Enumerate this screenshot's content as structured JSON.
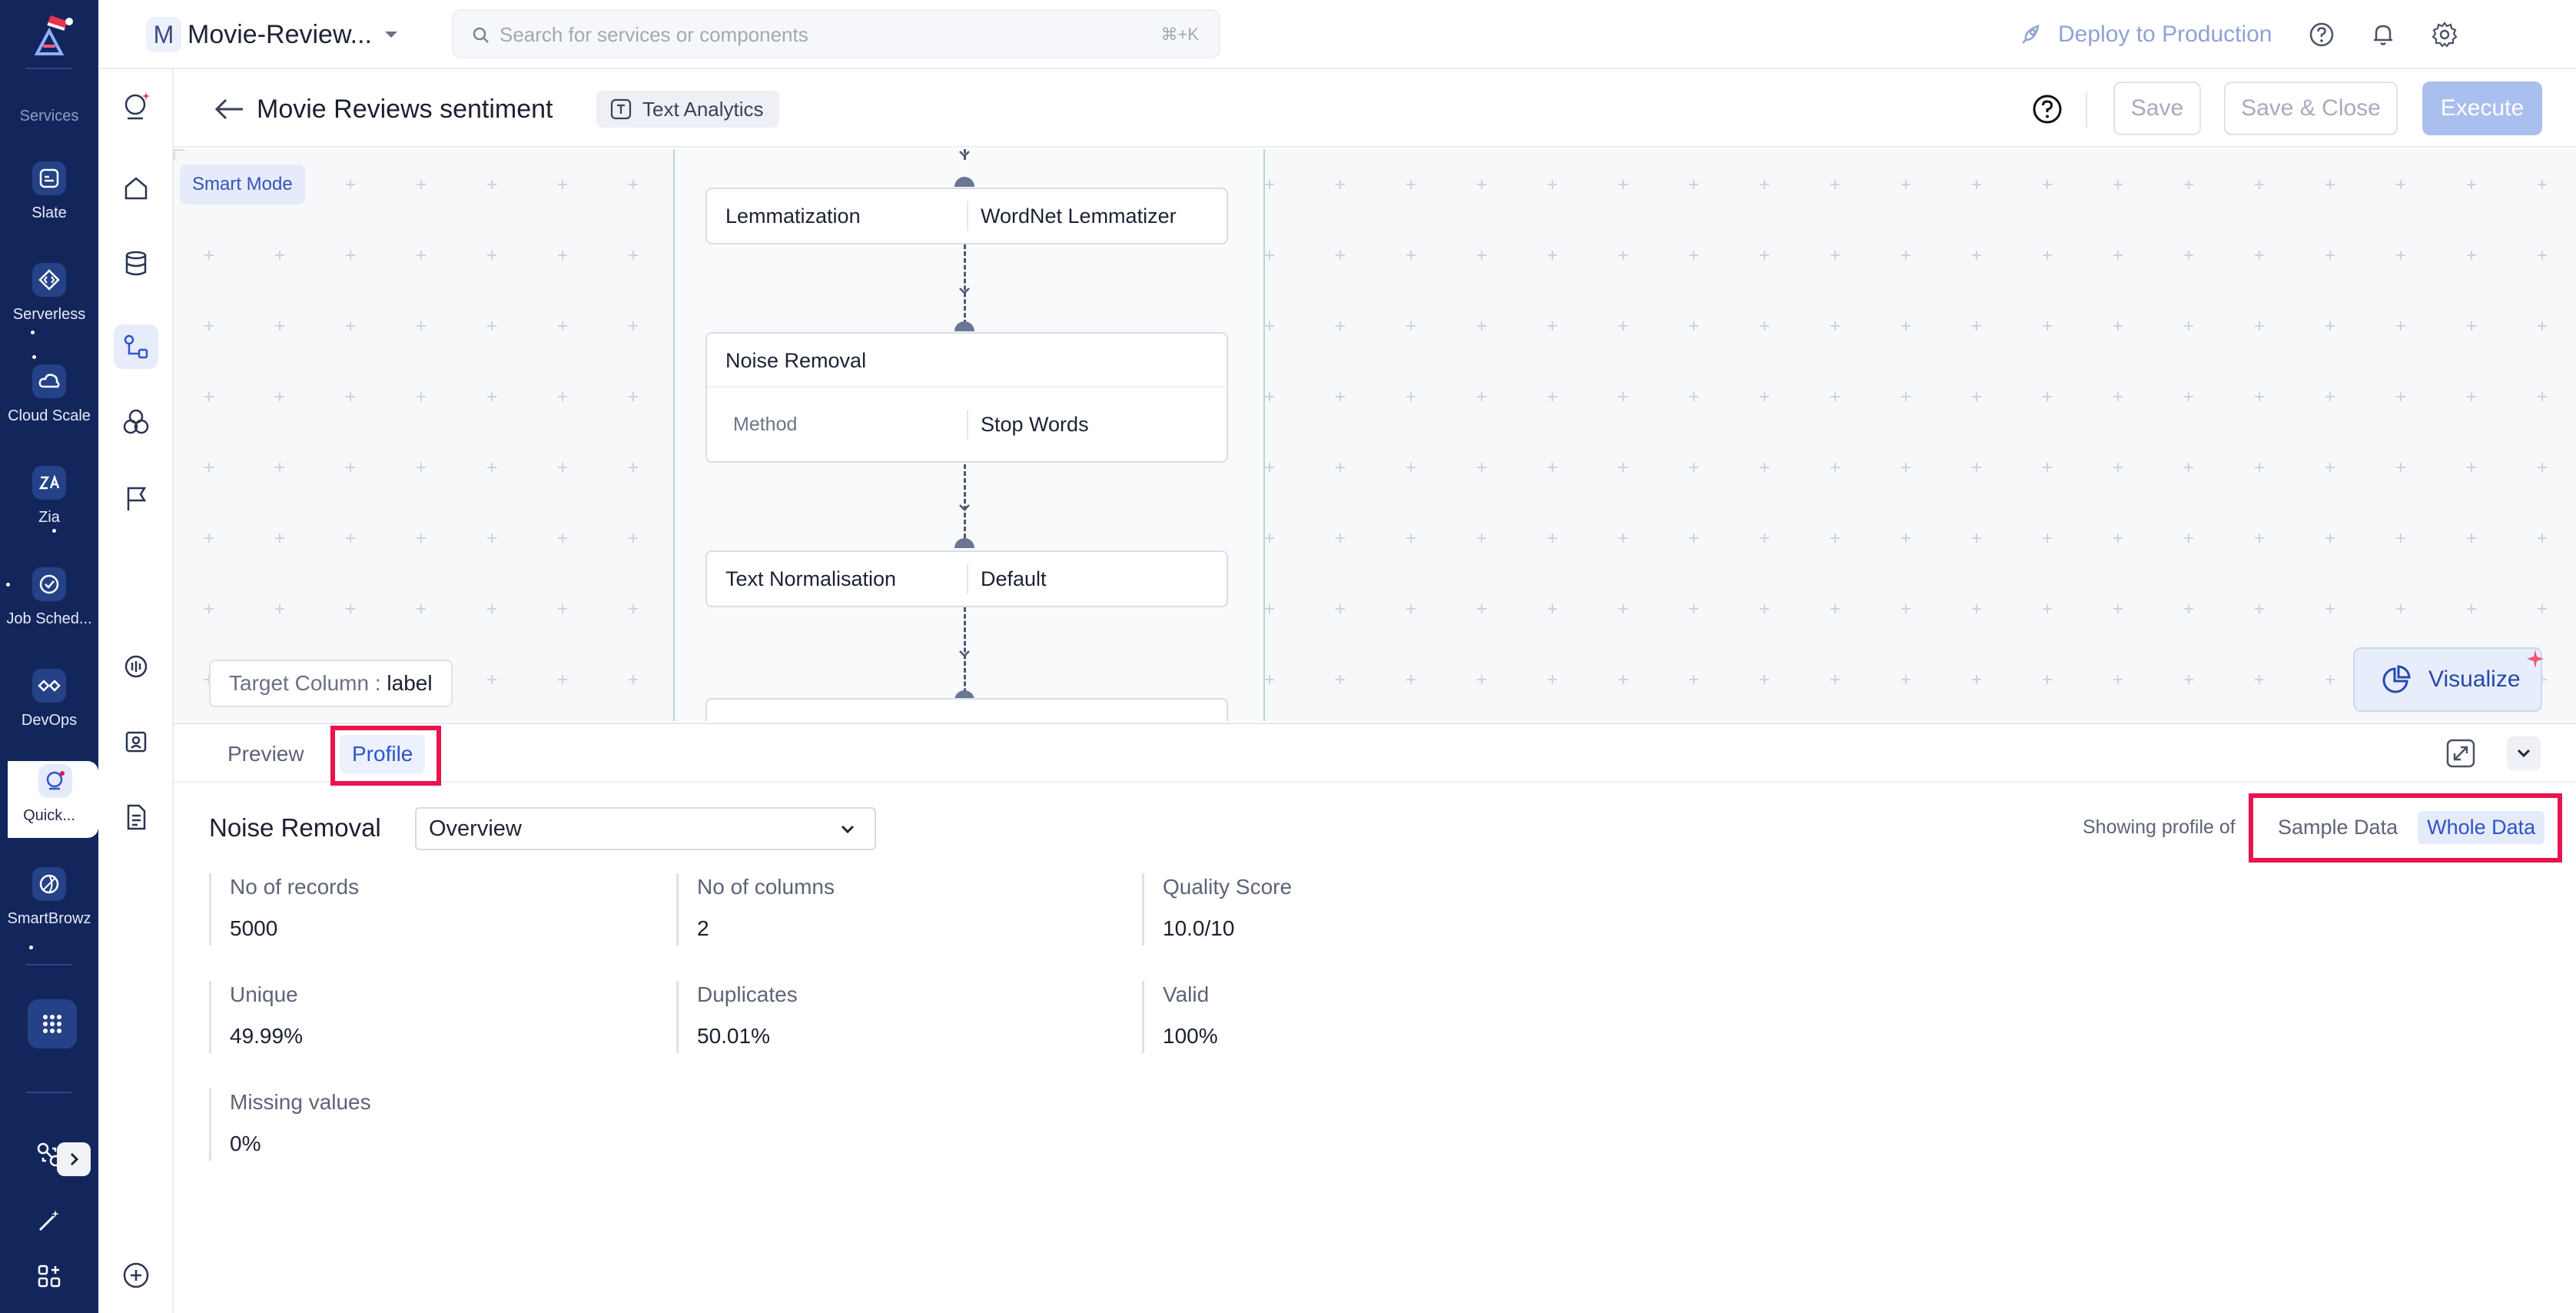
{
  "rail": {
    "section_label": "Services",
    "items": [
      {
        "label": "Slate",
        "icon": "slate-icon"
      },
      {
        "label": "Serverless",
        "icon": "serverless-icon"
      },
      {
        "label": "Cloud Scale",
        "icon": "cloud-scale-icon"
      },
      {
        "label": "Zia",
        "icon": "zia-icon"
      },
      {
        "label": "Job Sched...",
        "icon": "job-scheduler-icon"
      },
      {
        "label": "DevOps",
        "icon": "devops-icon"
      },
      {
        "label": "Quick...",
        "icon": "quickml-icon"
      },
      {
        "label": "SmartBrowz",
        "icon": "smartbrowz-icon"
      }
    ],
    "active_item": "Quick..."
  },
  "topbar": {
    "project_initial": "M",
    "project_name": "Movie-Review...",
    "search_placeholder": "Search for services or components",
    "search_shortcut": "⌘+K",
    "deploy_label": "Deploy to Production"
  },
  "page": {
    "title": "Movie Reviews sentiment",
    "tag": "Text Analytics",
    "save_label": "Save",
    "save_close_label": "Save & Close",
    "execute_label": "Execute"
  },
  "canvas": {
    "smart_mode_label": "Smart Mode",
    "nodes": [
      {
        "label": "Lemmatization",
        "value": "WordNet Lemmatizer"
      },
      {
        "title": "Noise Removal",
        "sub_label": "Method",
        "sub_value": "Stop Words"
      },
      {
        "label": "Text Normalisation",
        "value": "Default"
      }
    ],
    "target_column_label": "Target Column :",
    "target_column_value": "label",
    "visualize_label": "Visualize"
  },
  "panel": {
    "tabs": [
      "Preview",
      "Profile"
    ],
    "active_tab": "Profile",
    "step_title": "Noise Removal",
    "view_select": "Overview",
    "showing_label": "Showing profile of",
    "data_options": [
      "Sample Data",
      "Whole Data"
    ],
    "active_data_option": "Whole Data",
    "stats": [
      {
        "label": "No of records",
        "value": "5000"
      },
      {
        "label": "No of columns",
        "value": "2"
      },
      {
        "label": "Quality Score",
        "value": "10.0/10"
      },
      {
        "label": "Unique",
        "value": "49.99%"
      },
      {
        "label": "Duplicates",
        "value": "50.01%"
      },
      {
        "label": "Valid",
        "value": "100%"
      },
      {
        "label": "Missing values",
        "value": "0%"
      }
    ]
  },
  "colors": {
    "rail_bg": "#13265c",
    "accent": "#2e55c6",
    "highlight_box": "#e8144f",
    "execute_bg": "#a9bfee"
  }
}
